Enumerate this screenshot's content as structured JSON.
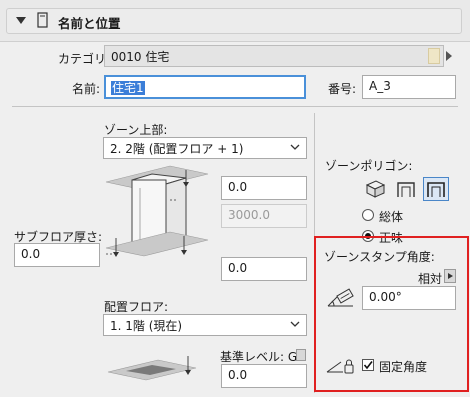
{
  "header": {
    "title": "名前と位置"
  },
  "category": {
    "label": "カテゴリ:",
    "value": "0010  住宅"
  },
  "name": {
    "label": "名前:",
    "value": "住宅1"
  },
  "number": {
    "label": "番号:",
    "value": "A_3"
  },
  "zone_top": {
    "label": "ゾーン上部:",
    "selected": "2. 2階 (配置フロア + 1)"
  },
  "height_fields": {
    "top_offset": "0.0",
    "height": "3000.0",
    "bottom_offset": "0.0"
  },
  "subfloor": {
    "label": "サブフロア厚さ:",
    "value": "0.0"
  },
  "placement_floor": {
    "label": "配置フロア:",
    "selected": "1. 1階 (現在)"
  },
  "ref_level": {
    "label": "基準レベル: GL",
    "value": "0.0"
  },
  "zone_polygon": {
    "label": "ゾーンポリゴン:",
    "radio_gross": "総体",
    "radio_net": "正味",
    "selected": "正味"
  },
  "zone_stamp_angle": {
    "label": "ゾーンスタンプ角度:",
    "relative": "相対",
    "angle_value": "0.00°",
    "fixed_angle": "固定角度",
    "fixed_checked": true
  },
  "colors": {
    "highlight_border": "#e02020",
    "focus_blue": "#4a90d9",
    "selection_blue": "#3b7ed8"
  }
}
